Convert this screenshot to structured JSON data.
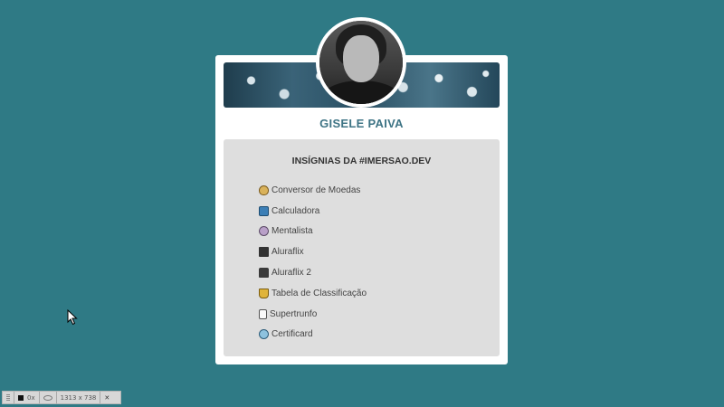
{
  "profile": {
    "name": "GISELE PAIVA"
  },
  "badges": {
    "title": "INSÍGNIAS DA #IMERSAO.DEV",
    "items": [
      {
        "label": "Conversor de Moedas",
        "icon": "money-bag-icon"
      },
      {
        "label": "Calculadora",
        "icon": "calculator-icon"
      },
      {
        "label": "Mentalista",
        "icon": "brain-icon"
      },
      {
        "label": "Aluraflix",
        "icon": "clapperboard-icon"
      },
      {
        "label": "Aluraflix 2",
        "icon": "video-camera-icon"
      },
      {
        "label": "Tabela de Classificação",
        "icon": "trophy-icon"
      },
      {
        "label": "Supertrunfo",
        "icon": "playing-card-icon"
      },
      {
        "label": "Certificard",
        "icon": "globe-icon"
      }
    ]
  },
  "taskbar": {
    "zoom": "0x",
    "dimensions": "1313 x 738",
    "close": "✕"
  },
  "colors": {
    "background": "#2f7a85",
    "name": "#3e7485",
    "panel": "#dedede"
  }
}
